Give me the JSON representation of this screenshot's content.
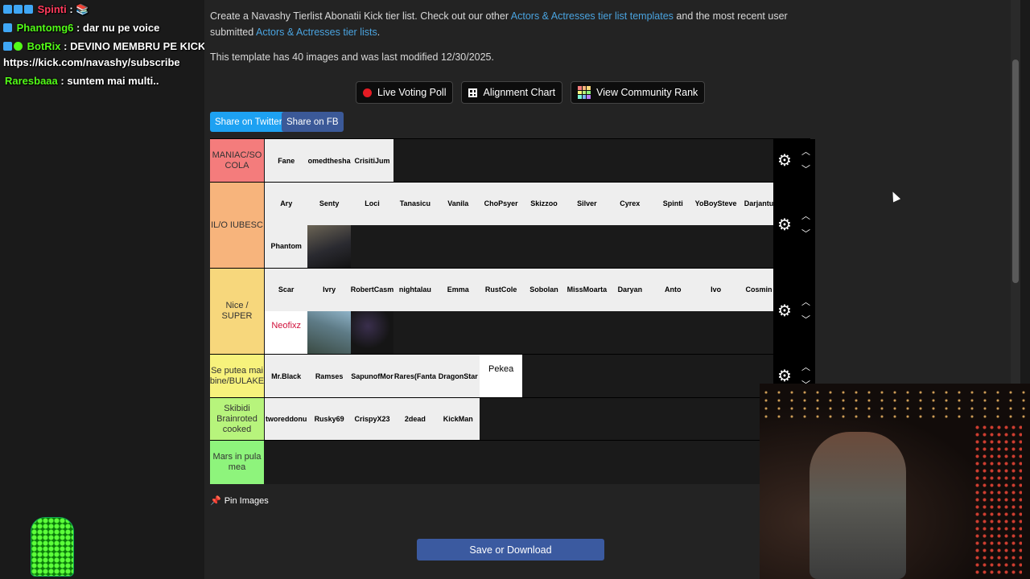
{
  "chat": [
    {
      "user": "Spinti",
      "sep": " :",
      "msg": "",
      "color": "#ff3b5c"
    },
    {
      "user": "Phantomg6",
      "sep": " :",
      "msg": "dar nu pe voice",
      "color": "#53fc18"
    },
    {
      "user": "BotRix",
      "sep": " :",
      "msg": "DEVINO MEMBRU PE KICK",
      "color": "#53fc18"
    },
    {
      "user": "",
      "sep": "",
      "msg": "https://kick.com/navashy/subscribe",
      "color": "#ffffff"
    },
    {
      "user": "Raresbaaa",
      "sep": " :",
      "msg": "suntem mai multi..",
      "color": "#53fc18"
    }
  ],
  "intro": {
    "t1": "Create a Navashy Tierlist Abonatii Kick tier list. Check out our other ",
    "link1": "Actors & Actresses tier list templates",
    "t2": " and the most recent user submitted ",
    "link2": "Actors & Actresses tier lists",
    "t3": "."
  },
  "meta": "This template has 40 images and was last modified 12/30/2025.",
  "buttons": {
    "live_voting": "Live Voting Poll",
    "alignment": "Alignment Chart",
    "community": "View Community Rank"
  },
  "share": {
    "twitter": "Share on Twitter",
    "fb": "Share on FB"
  },
  "tiers": [
    {
      "label": "MANIAC/SO COLA",
      "color": "#f47c7c",
      "items": [
        "Fane",
        "omedthesha",
        "CrisitiJum"
      ]
    },
    {
      "label": "IL/O IUBESC",
      "color": "#f7b47c",
      "items": [
        "Ary",
        "Senty",
        "Loci",
        "Tanasicu",
        "Vanila",
        "ChoPsyer",
        "Skizzoo",
        "Silver",
        "Cyrex",
        "Spinti",
        "YoBoySteve",
        "Darjantu",
        "Phantom",
        "[photo]"
      ]
    },
    {
      "label": "Nice / SUPER",
      "color": "#f7d77c",
      "items": [
        "Scar",
        "Ivry",
        "RobertCasm",
        "nightalau",
        "Emma",
        "RustCole",
        "Sobolan",
        "MissMoarta",
        "Daryan",
        "Anto",
        "Ivo",
        "Cosmin",
        "Neofixz",
        "[photo2]",
        "[photo3]"
      ]
    },
    {
      "label": "Se putea mai bine/BULAKE",
      "color": "#f7f27c",
      "items": [
        "Mr.Black",
        "Ramses",
        "SapunofMor",
        "Rares(Fanta",
        "DragonStar",
        "Pekea"
      ]
    },
    {
      "label": "Skibidi Brainroted cooked",
      "color": "#b7f47c",
      "items": [
        "tworeddonu",
        "Rusky69",
        "CrispyX23",
        "2dead",
        "KickMan"
      ]
    },
    {
      "label": "Mars in pula mea",
      "color": "#8ef47c",
      "items": []
    }
  ],
  "pin": "Pin Images",
  "save": "Save or Download"
}
